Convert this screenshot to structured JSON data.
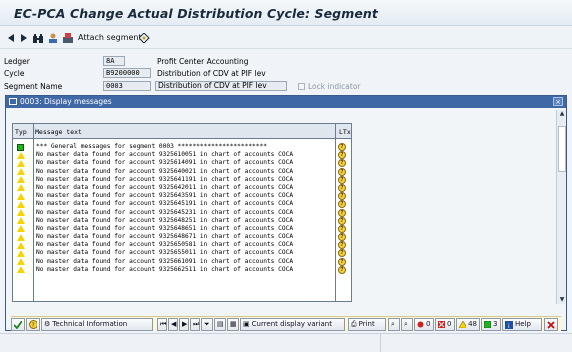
{
  "window": {
    "title": "EC-PCA Change Actual Distribution Cycle: Segment"
  },
  "toolbar": {
    "back_icon": "back-arrow-icon",
    "forward_icon": "forward-arrow-icon",
    "attach_label": "Attach segment"
  },
  "form": {
    "ledger": {
      "label": "Ledger",
      "value": "8A",
      "description": "Profit Center Accounting"
    },
    "cycle": {
      "label": "Cycle",
      "value": "B9200000",
      "description": "Distribution of CDV at PIF lev"
    },
    "segment": {
      "label": "Segment Name",
      "value": "0003",
      "description": "Distribution of CDV at PIF lev"
    },
    "lock_label": "Lock indicator"
  },
  "dialog": {
    "title": "0003: Display messages",
    "close_label": "×",
    "columns": {
      "typ": "Typ",
      "message": "Message text",
      "ltxt": "LTxt"
    },
    "rows": [
      {
        "type": "success",
        "text": "*** General messages for segment 0003      ************************"
      },
      {
        "type": "warning",
        "text": "No master data found for account 9325610051 in chart of accounts COCA"
      },
      {
        "type": "warning",
        "text": "No master data found for account 9325614091 in chart of accounts COCA"
      },
      {
        "type": "warning",
        "text": "No master data found for account 9325640021 in chart of accounts COCA"
      },
      {
        "type": "warning",
        "text": "No master data found for account 9325641191 in chart of accounts COCA"
      },
      {
        "type": "warning",
        "text": "No master data found for account 9325642011 in chart of accounts COCA"
      },
      {
        "type": "warning",
        "text": "No master data found for account 9325643591 in chart of accounts COCA"
      },
      {
        "type": "warning",
        "text": "No master data found for account 9325645191 in chart of accounts COCA"
      },
      {
        "type": "warning",
        "text": "No master data found for account 9325645231 in chart of accounts COCA"
      },
      {
        "type": "warning",
        "text": "No master data found for account 9325648251 in chart of accounts COCA"
      },
      {
        "type": "warning",
        "text": "No master data found for account 9325648651 in chart of accounts COCA"
      },
      {
        "type": "warning",
        "text": "No master data found for account 9325648671 in chart of accounts COCA"
      },
      {
        "type": "warning",
        "text": "No master data found for account 9325650581 in chart of accounts COCA"
      },
      {
        "type": "warning",
        "text": "No master data found for account 9325655011 in chart of accounts COCA"
      },
      {
        "type": "warning",
        "text": "No master data found for account 9325661091 in chart of accounts COCA"
      },
      {
        "type": "warning",
        "text": "No master data found for account 9325662511 in chart of accounts COCA"
      }
    ],
    "buttons": {
      "technical_info": "Technical Information",
      "current_variant": "Current display variant",
      "print": "Print",
      "error_count": "0",
      "abort_count": "0",
      "warning_count": "48",
      "success_count": "3",
      "help": "Help"
    }
  },
  "colors": {
    "dialog_header": "#3f68a6",
    "warning": "#f6d400",
    "success": "#22b022",
    "error": "#d02020"
  }
}
